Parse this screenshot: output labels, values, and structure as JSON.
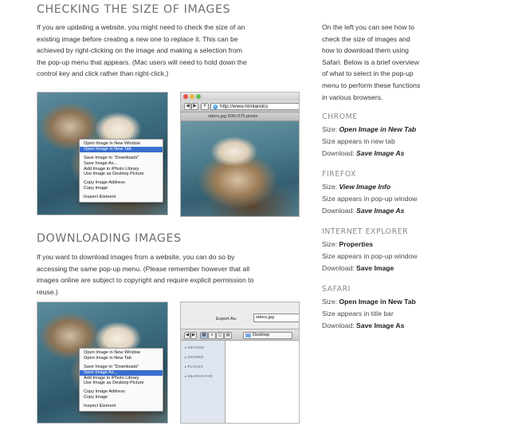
{
  "section1": {
    "heading": "CHECKING THE SIZE OF IMAGES",
    "paragraph": [
      "If you are updating a website, you might need to check the size of an",
      "existing image before creating a new one to replace it. This can be",
      "achieved by right-clicking on the image and making a selection from",
      "the pop-up menu that appears. (Mac users will need to hold down the",
      "control key and click rather than right-click.)"
    ]
  },
  "menu1": {
    "items": [
      "Open Image in New Window",
      "Open Image in New Tab",
      "",
      "Save Image to \"Downloads\"",
      "Save Image As...",
      "Add Image to iPhoto Library",
      "Use Image as Desktop Picture",
      "",
      "Copy Image Address",
      "Copy Image",
      "",
      "Inspect Element"
    ],
    "highlighted": 1
  },
  "browser": {
    "url": "http://www.htmlandcs",
    "back": "◀",
    "forward": "▶",
    "add": "+",
    "tab_title": "otters.jpg 500×375 pixels"
  },
  "section2": {
    "heading": "DOWNLOADING IMAGES",
    "paragraph": [
      "If you want to download images from a website, you can do so by",
      "accessing the same pop-up menu. (Please remember however that all",
      "images online are subject to copyright and require explicit permission to",
      "reuse.)"
    ]
  },
  "menu2": {
    "items": [
      "Open Image in New Window",
      "Open Image in New Tab",
      "",
      "Save Image to \"Downloads\"",
      "Save Image As...",
      "Add Image to iPhoto Library",
      "Use Image as Desktop Picture",
      "",
      "Copy Image Address",
      "Copy Image",
      "",
      "Inspect Element"
    ],
    "highlighted": 4
  },
  "save_dialog": {
    "export_label": "Export As:",
    "filename": "otters.jpg",
    "location": "Desktop",
    "sidebar": [
      "DEVICES",
      "SHARED",
      "PLACES",
      "SEARCH FOR"
    ]
  },
  "right_column": {
    "intro": [
      "On the left you can see how to",
      "check the size of images and",
      "how to download them using",
      "Safari. Below is a brief overview",
      "of what to select in the pop-up",
      "menu to perform these functions",
      "in various browsers."
    ],
    "browsers": [
      {
        "name": "CHROME",
        "size_label": "Size:",
        "size_value": "Open Image in New Tab",
        "size_italic": true,
        "appears": "Size appears in new tab",
        "download_label": "Download:",
        "download_value": "Save Image As",
        "download_italic": true
      },
      {
        "name": "FIREFOX",
        "size_label": "Size:",
        "size_value": "View Image Info",
        "size_italic": true,
        "appears": "Size appears in pop-up window",
        "download_label": "Download:",
        "download_value": "Save Image As",
        "download_italic": true
      },
      {
        "name": "INTERNET EXPLORER",
        "size_label": "Size:",
        "size_value": "Properties",
        "size_italic": false,
        "appears": "Size appears in pop-up window",
        "download_label": "Download:",
        "download_value": "Save Image",
        "download_italic": false
      },
      {
        "name": "SAFARI",
        "size_label": "Size:",
        "size_value": "Open Image in New Tab",
        "size_italic": false,
        "appears": "Size appears in title bar",
        "download_label": "Download:",
        "download_value": "Save Image As",
        "download_italic": false
      }
    ]
  },
  "colors": {
    "heading": "#6f6f6f",
    "menu_highlight": "#3a6fd1",
    "body_text": "#333333"
  }
}
